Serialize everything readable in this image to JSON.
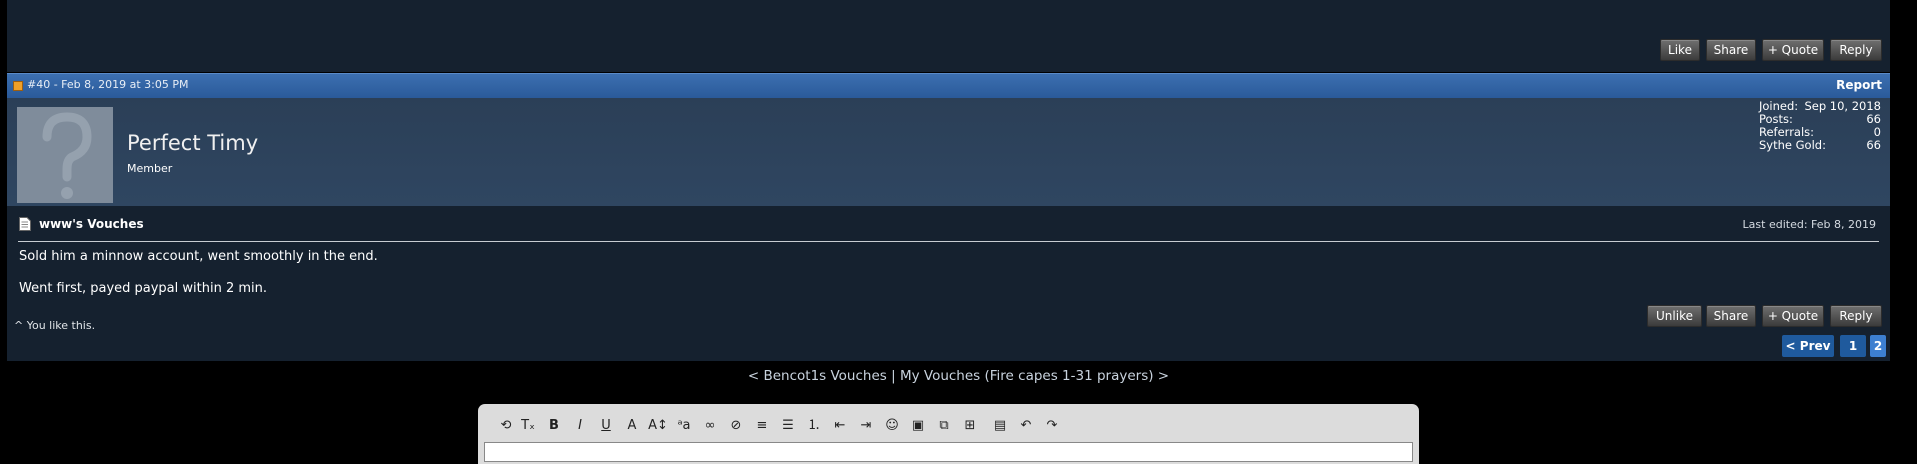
{
  "top_actions": {
    "like": "Like",
    "share": "Share",
    "quote": "+ Quote",
    "reply": "Reply"
  },
  "post": {
    "meta": "#40 - Feb 8, 2019 at 3:05 PM",
    "report": "Report",
    "user": {
      "name": "Perfect Timy",
      "title": "Member",
      "stats": [
        {
          "label": "Joined:",
          "value": "Sep 10, 2018"
        },
        {
          "label": "Posts:",
          "value": "66"
        },
        {
          "label": "Referrals:",
          "value": "0"
        },
        {
          "label": "Sythe Gold:",
          "value": "66"
        }
      ]
    },
    "vouch_title": "www's Vouches",
    "last_edited": "Last edited: Feb 8, 2019",
    "lines": [
      "Sold him a minnow account, went smoothly in the end.",
      "Went first, payed paypal within 2 min."
    ],
    "like_note": "^ You like this.",
    "actions": {
      "unlike": "Unlike",
      "share": "Share",
      "quote": "+ Quote",
      "reply": "Reply"
    }
  },
  "pagination": {
    "prev": "< Prev",
    "pages": [
      "1",
      "2"
    ],
    "current": "2"
  },
  "thread_nav": {
    "prev_link": "< Bencot1s Vouches",
    "separator": " | ",
    "next_link": "My Vouches (Fire capes 1-31 prayers) >"
  },
  "editor": {
    "tools": [
      {
        "name": "source-icon",
        "glyph": "⟲"
      },
      {
        "name": "remove-format-icon",
        "glyph": "Tₓ"
      },
      {
        "name": "bold-icon",
        "glyph": "B"
      },
      {
        "name": "italic-icon",
        "glyph": "I"
      },
      {
        "name": "underline-icon",
        "glyph": "U"
      },
      {
        "name": "font-color-icon",
        "glyph": "A"
      },
      {
        "name": "font-size-icon",
        "glyph": "A↕"
      },
      {
        "name": "font-family-icon",
        "glyph": "ᵃa"
      },
      {
        "name": "link-icon",
        "glyph": "∞"
      },
      {
        "name": "unlink-icon",
        "glyph": "⊘"
      },
      {
        "name": "align-icon",
        "glyph": "≡"
      },
      {
        "name": "bullet-list-icon",
        "glyph": "☰"
      },
      {
        "name": "number-list-icon",
        "glyph": "⒈"
      },
      {
        "name": "outdent-icon",
        "glyph": "⇤"
      },
      {
        "name": "indent-icon",
        "glyph": "⇥"
      },
      {
        "name": "smiley-icon",
        "glyph": "☺"
      },
      {
        "name": "image-icon",
        "glyph": "▣"
      },
      {
        "name": "media-icon",
        "glyph": "⧉"
      },
      {
        "name": "insert-icon",
        "glyph": "⊞"
      },
      {
        "name": "save-draft-icon",
        "glyph": "▤"
      },
      {
        "name": "undo-icon",
        "glyph": "↶"
      },
      {
        "name": "redo-icon",
        "glyph": "↷"
      }
    ]
  }
}
